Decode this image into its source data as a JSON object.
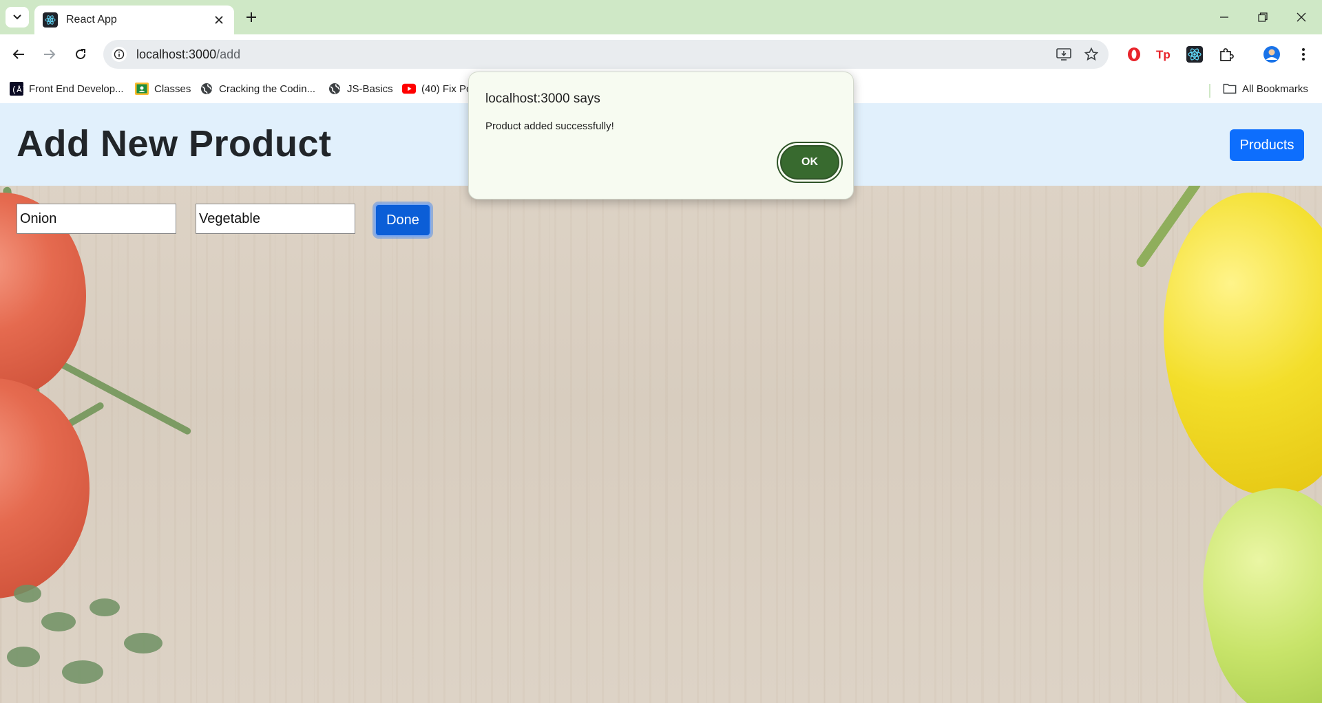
{
  "browser": {
    "tab_title": "React App",
    "url_host": "localhost:3000",
    "url_path": "/add",
    "bookmarks": [
      {
        "label": "Front End Develop...",
        "icon": "freecodecamp-icon"
      },
      {
        "label": "Classes",
        "icon": "classroom-icon"
      },
      {
        "label": "Cracking the Codin...",
        "icon": "globe-icon"
      },
      {
        "label": "JS-Basics",
        "icon": "globe-icon"
      },
      {
        "label": "(40) Fix Po",
        "icon": "youtube-icon"
      }
    ],
    "all_bookmarks_label": "All Bookmarks"
  },
  "page": {
    "title": "Add New Product",
    "products_button": "Products",
    "name_value": "Onion",
    "category_value": "Vegetable",
    "done_button": "Done"
  },
  "dialog": {
    "title": "localhost:3000 says",
    "message": "Product added successfully!",
    "ok_label": "OK"
  },
  "colors": {
    "tabstrip": "#cfe8c6",
    "header_band": "#e1f0fc",
    "primary_button": "#0d6efd",
    "dialog_ok": "#386a2f"
  }
}
